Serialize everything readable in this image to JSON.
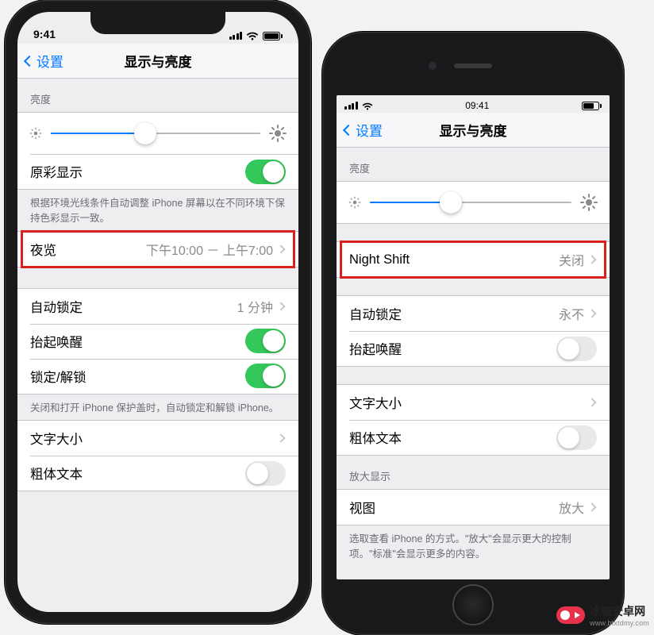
{
  "left": {
    "status_time": "9:41",
    "back_label": "设置",
    "nav_title": "显示与亮度",
    "brightness_header": "亮度",
    "brightness_pct": 45,
    "truetone_label": "原彩显示",
    "truetone_on": true,
    "truetone_footer": "根据环境光线条件自动调整 iPhone 屏幕以在不同环境下保持色彩显示一致。",
    "nightshift_label": "夜览",
    "nightshift_value": "下午10:00 － 上午7:00",
    "autolock_label": "自动锁定",
    "autolock_value": "1 分钟",
    "raise_label": "抬起唤醒",
    "raise_on": true,
    "lockunlock_label": "锁定/解锁",
    "lockunlock_on": true,
    "lockunlock_footer": "关闭和打开 iPhone 保护盖时，自动锁定和解锁 iPhone。",
    "textsize_label": "文字大小",
    "boldtext_label": "粗体文本",
    "boldtext_on": false
  },
  "right": {
    "status_time": "09:41",
    "back_label": "设置",
    "nav_title": "显示与亮度",
    "brightness_header": "亮度",
    "brightness_pct": 40,
    "nightshift_label": "Night Shift",
    "nightshift_value": "关闭",
    "autolock_label": "自动锁定",
    "autolock_value": "永不",
    "raise_label": "抬起唤醒",
    "raise_on": false,
    "textsize_label": "文字大小",
    "boldtext_label": "粗体文本",
    "boldtext_on": false,
    "zoom_header": "放大显示",
    "zoom_label": "视图",
    "zoom_value": "放大",
    "zoom_footer": "选取查看 iPhone 的方式。\"放大\"会显示更大的控制项。\"标准\"会显示更多的内容。"
  },
  "watermark": {
    "title": "冰糖安卓网",
    "url": "www.btxtdmy.com"
  }
}
